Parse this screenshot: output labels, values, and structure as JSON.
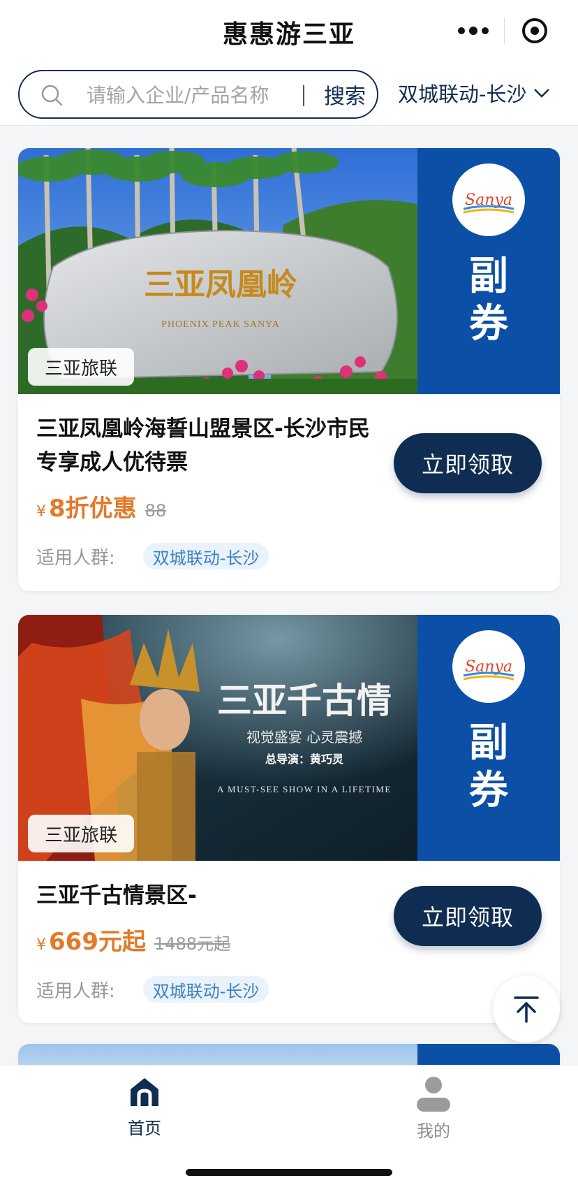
{
  "header": {
    "title": "惠惠游三亚",
    "search_placeholder": "请输入企业/产品名称",
    "search_button": "搜索",
    "city_selector": "双城联动-长沙"
  },
  "cards": [
    {
      "photo_text_cn": "三亚凤凰岭",
      "photo_text_en": "PHOENIX PEAK SANYA",
      "source_tag": "三亚旅联",
      "side_label_1": "副",
      "side_label_2": "券",
      "logo_text": "Sanya",
      "title": "三亚凤凰岭海誓山盟景区-长沙市民专享成人优待票",
      "currency": "¥",
      "price": "8折优惠",
      "original_price": "88",
      "audience_label": "适用人群:",
      "audience_tag": "双城联动-长沙",
      "claim_button": "立即领取"
    },
    {
      "photo_text_cn": "三亚千古情",
      "photo_subtitle": "视觉盛宴 心灵震撼",
      "photo_director": "总导演：黄巧灵",
      "photo_text_en": "A MUST-SEE SHOW IN A LIFETIME",
      "source_tag": "三亚旅联",
      "side_label_1": "副",
      "side_label_2": "券",
      "logo_text": "Sanya",
      "title": "三亚千古情景区-",
      "currency": "¥",
      "price": "669元起",
      "original_price": "1488元起",
      "audience_label": "适用人群:",
      "audience_tag": "双城联动-长沙",
      "claim_button": "立即领取"
    }
  ],
  "tabbar": {
    "items": [
      {
        "label": "首页",
        "icon": "home-icon",
        "active": true
      },
      {
        "label": "我的",
        "icon": "user-icon",
        "active": false
      }
    ]
  },
  "colors": {
    "brand_navy": "#0f2d52",
    "coupon_blue": "#0b4fa7",
    "price_orange": "#e37a28",
    "tag_blue": "#3b7fc4"
  }
}
